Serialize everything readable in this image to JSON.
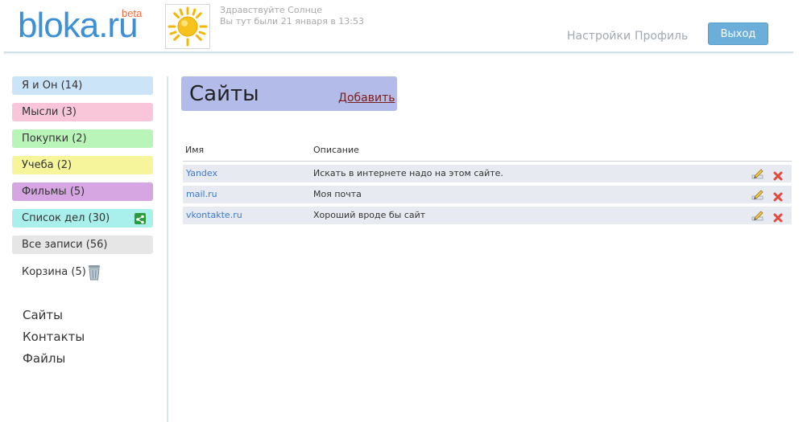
{
  "header": {
    "logo_text": "bloka.ru",
    "beta_label": "beta",
    "greeting": "Здравствуйте Солнце",
    "last_visit": "Вы тут были 21 января в 13:53",
    "nav": {
      "settings": "Настройки",
      "profile": "Профиль"
    },
    "logout_label": "Выход"
  },
  "sidebar": {
    "categories": [
      {
        "label": "Я и Он (14)",
        "color": "#cce4f7"
      },
      {
        "label": "Мысли (3)",
        "color": "#f9c6d9"
      },
      {
        "label": "Покупки (2)",
        "color": "#b9f4b9"
      },
      {
        "label": "Учеба (2)",
        "color": "#f6f59b"
      },
      {
        "label": "Фильмы (5)",
        "color": "#d6a6e3"
      },
      {
        "label": "Список дел (30)",
        "color": "#a9f0ec"
      },
      {
        "label": "Все записи (56)",
        "color": "#e6e6e6"
      }
    ],
    "trash_label": "Корзина (5)",
    "sections": [
      "Сайты",
      "Контакты",
      "Файлы"
    ]
  },
  "main": {
    "title": "Сайты",
    "add_label": "Добавить",
    "columns": {
      "name": "Имя",
      "description": "Описание"
    },
    "rows": [
      {
        "name": "Yandex",
        "description": "Искать в интернете надо на этом сайте."
      },
      {
        "name": "mail.ru",
        "description": "Моя почта"
      },
      {
        "name": "vkontakte.ru",
        "description": "Хороший вроде бы сайт"
      }
    ]
  },
  "colors": {
    "logo": "#3d8fd6",
    "title_box": "#b3bbe9",
    "logout_button": "#6aaed9",
    "link": "#3b7ac9",
    "delete_icon": "#e04b3f"
  },
  "icons": [
    "sun-avatar-icon",
    "share-icon",
    "trash-bin-icon",
    "edit-icon",
    "delete-icon"
  ]
}
